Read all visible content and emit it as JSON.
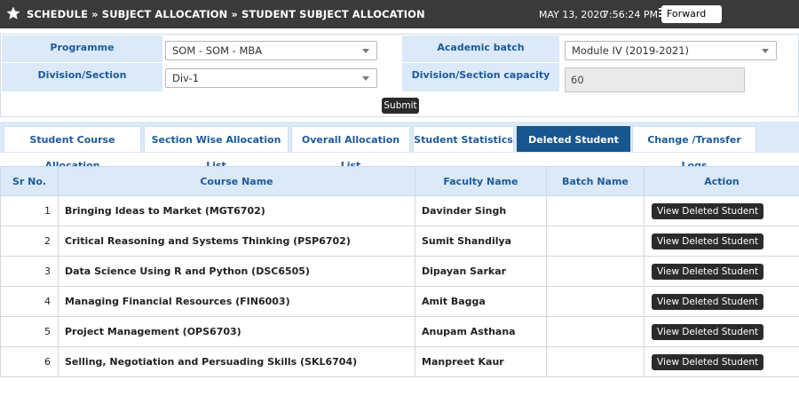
{
  "header": {
    "breadcrumb": "SCHEDULE » SUBJECT ALLOCATION » STUDENT SUBJECT ALLOCATION",
    "date": "MAY 13, 2020",
    "time": "7:56:24 PM",
    "forward_label": "Forward",
    "star_icon": "star-icon",
    "menu_icon": "menu-icon"
  },
  "form": {
    "programme_label": "Programme",
    "programme_value": "SOM - SOM - MBA",
    "academic_batch_label": "Academic batch",
    "academic_batch_value": "Module IV (2019-2021)",
    "division_label": "Division/Section",
    "division_value": "Div-1",
    "capacity_label": "Division/Section capacity",
    "capacity_value": "60",
    "submit_label": "Submit"
  },
  "tabs": [
    {
      "label": "Student Course Allocation",
      "active": false
    },
    {
      "label": "Section Wise Allocation List",
      "active": false
    },
    {
      "label": "Overall Allocation List",
      "active": false
    },
    {
      "label": "Student Statistics",
      "active": false
    },
    {
      "label": "Deleted Student List",
      "active": true
    },
    {
      "label": "Change /Transfer Logs",
      "active": false
    }
  ],
  "table": {
    "headers": [
      "Sr No.",
      "Course Name",
      "Faculty Name",
      "Batch Name",
      "Action"
    ],
    "rows": [
      {
        "sr": "1",
        "course": "Bringing Ideas to Market (MGT6702)",
        "faculty": "Davinder Singh",
        "batch": "",
        "action": "View Deleted Student"
      },
      {
        "sr": "2",
        "course": "Critical Reasoning and Systems Thinking (PSP6702)",
        "faculty": "Sumit Shandilya",
        "batch": "",
        "action": "View Deleted Student"
      },
      {
        "sr": "3",
        "course": "Data Science Using R and Python (DSC6505)",
        "faculty": "Dipayan Sarkar",
        "batch": "",
        "action": "View Deleted Student"
      },
      {
        "sr": "4",
        "course": "Managing Financial Resources (FIN6003)",
        "faculty": "Amit Bagga",
        "batch": "",
        "action": "View Deleted Student"
      },
      {
        "sr": "5",
        "course": "Project Management (OPS6703)",
        "faculty": "Anupam Asthana",
        "batch": "",
        "action": "View Deleted Student"
      },
      {
        "sr": "6",
        "course": "Selling, Negotiation and Persuading Skills (SKL6704)",
        "faculty": "Manpreet Kaur",
        "batch": "",
        "action": "View Deleted Student"
      }
    ]
  }
}
